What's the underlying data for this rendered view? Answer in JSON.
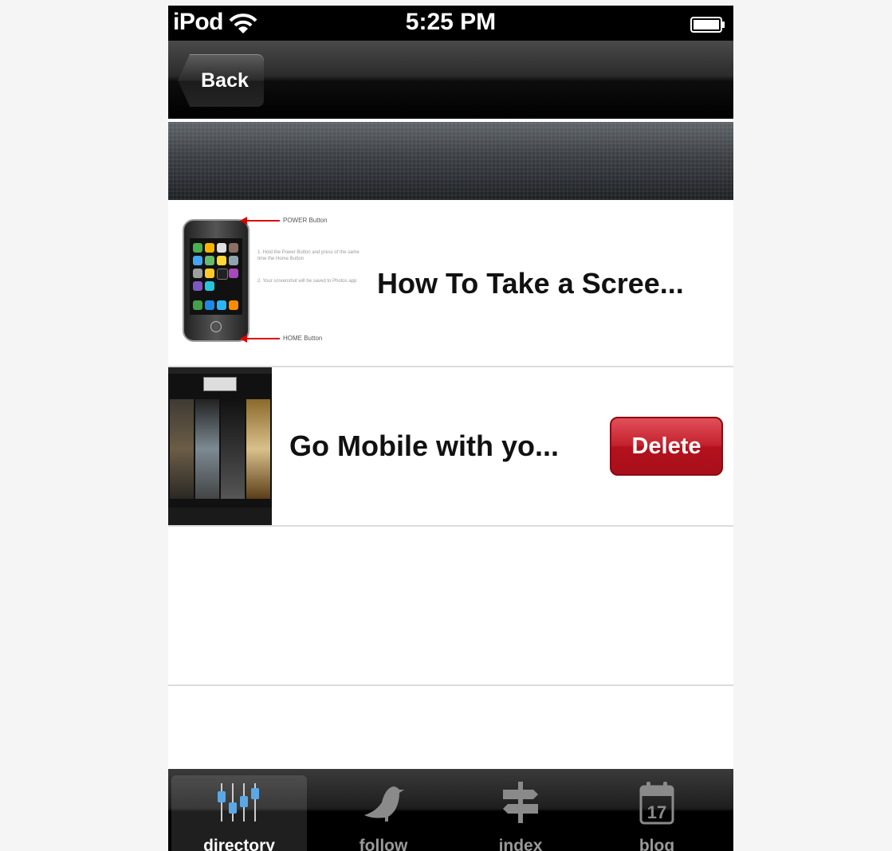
{
  "status_bar": {
    "carrier": "iPod",
    "time": "5:25 PM",
    "wifi_icon": "wifi-icon",
    "battery_icon": "battery-icon"
  },
  "nav": {
    "back_label": "Back"
  },
  "list": {
    "items": [
      {
        "title": "How To Take a Scree...",
        "thumbnail": "iphone-screenshot-guide",
        "thumb_annotations": {
          "power": "POWER Button",
          "home": "HOME Button",
          "step1": "1. Hold the Power Button and press of the same time the Home Button",
          "step2": "2. Your screenshot will be saved to Photos app"
        }
      },
      {
        "title": "Go Mobile with yo...",
        "thumbnail": "mobile-app-screenshot",
        "delete_label": "Delete"
      }
    ]
  },
  "tabbar": {
    "tabs": [
      {
        "label": "directory",
        "icon": "directory-icon",
        "active": true
      },
      {
        "label": "follow",
        "icon": "bird-icon",
        "active": false
      },
      {
        "label": "index",
        "icon": "signpost-icon",
        "active": false
      },
      {
        "label": "blog",
        "icon": "calendar-icon",
        "calendar_day": "17",
        "active": false
      }
    ]
  },
  "colors": {
    "delete": "#c3222d",
    "tab_active": "#ffffff",
    "tab_inactive": "#9a9a9a"
  }
}
